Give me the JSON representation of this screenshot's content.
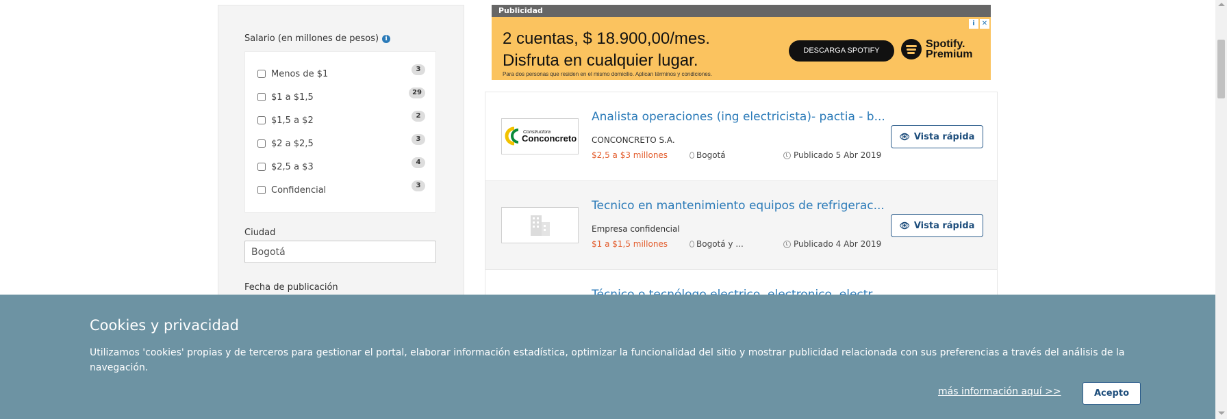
{
  "filters": {
    "salary_title": "Salario (en millones de pesos)",
    "salary_options": [
      {
        "label": "Menos de $1",
        "count": "3"
      },
      {
        "label": "$1 a $1,5",
        "count": "29"
      },
      {
        "label": "$1,5 a $2",
        "count": "2"
      },
      {
        "label": "$2 a $2,5",
        "count": "3"
      },
      {
        "label": "$2,5 a $3",
        "count": "4"
      },
      {
        "label": "Confidencial",
        "count": "3"
      }
    ],
    "city_label": "Ciudad",
    "city_value": "Bogotá",
    "date_label": "Fecha de publicación"
  },
  "ad": {
    "header": "Publicidad",
    "line1": "2 cuentas, $ 18.900,00/mes.",
    "line2": "Disfruta en cualquier lugar.",
    "footnote": "Para dos personas que residen en el mismo domicilio. Aplican términos y condiciones.",
    "cta": "DESCARGA SPOTIFY",
    "brand_line1": "Spotify.",
    "brand_line2": "Premium",
    "close_icons": [
      "i",
      "✕"
    ]
  },
  "jobs": [
    {
      "title": "Analista operaciones (ing electricista)- pactia - b...",
      "company": "CONCONCRETO S.A.",
      "salary": "$2,5 a $3 millones",
      "city": "Bogotá",
      "date": "Publicado 5 Abr 2019",
      "button": "Vista rápida",
      "logo_small": "Constructora",
      "logo_big": "Conconcreto"
    },
    {
      "title": "Tecnico en mantenimiento equipos de refrigerac...",
      "company": "Empresa confidencial",
      "salary": "$1 a $1,5 millones",
      "city": "Bogotá y ...",
      "date": "Publicado 4 Abr 2019",
      "button": "Vista rápida"
    },
    {
      "title": "Técnico o tecnólogo electrico, electronico, electr..."
    }
  ],
  "cookies": {
    "title": "Cookies y privacidad",
    "text": "Utilizamos 'cookies' propias y de terceros para gestionar el portal, elaborar información estadística, optimizar la funcionalidad del sitio y mostrar publicidad relacionada con sus preferencias a través del análisis de la navegación.",
    "more_link": "más información aquí >>",
    "accept": "Acepto"
  },
  "colors": {
    "link_blue": "#2a7ab8",
    "salary_orange": "#e35d2d",
    "cookie_bg": "#6d93a3",
    "ad_bg": "#fbc35f"
  }
}
